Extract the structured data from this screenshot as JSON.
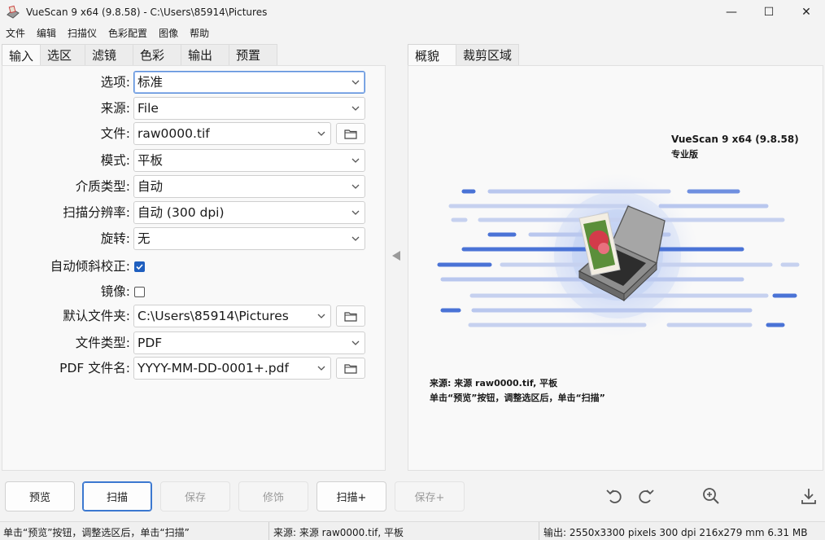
{
  "window": {
    "title": "VueScan 9 x64 (9.8.58)  -  C:\\Users\\85914\\Pictures",
    "minimize": "—",
    "maximize": "☐",
    "close": "✕"
  },
  "menu": [
    "文件",
    "编辑",
    "扫描仪",
    "色彩配置",
    "图像",
    "帮助"
  ],
  "left_tabs": [
    "输入",
    "选区",
    "滤镜",
    "色彩",
    "输出",
    "预置"
  ],
  "right_tabs": [
    "概貌",
    "裁剪区域"
  ],
  "form": {
    "options": {
      "label": "选项:",
      "value": "标准"
    },
    "source": {
      "label": "来源:",
      "value": "File"
    },
    "file": {
      "label": "文件:",
      "value": "raw0000.tif"
    },
    "mode": {
      "label": "模式:",
      "value": "平板"
    },
    "media": {
      "label": "介质类型:",
      "value": "自动"
    },
    "resolution": {
      "label": "扫描分辨率:",
      "value": "自动 (300 dpi)"
    },
    "rotation": {
      "label": "旋转:",
      "value": "无"
    },
    "deskew": {
      "label": "自动倾斜校正:",
      "checked": true
    },
    "mirror": {
      "label": "镜像:",
      "checked": false
    },
    "default_folder": {
      "label": "默认文件夹:",
      "value": "C:\\Users\\85914\\Pictures"
    },
    "file_type": {
      "label": "文件类型:",
      "value": "PDF"
    },
    "pdf_name": {
      "label": "PDF 文件名:",
      "value": "YYYY-MM-DD-0001+.pdf"
    }
  },
  "preview": {
    "product": "VueScan 9 x64 (9.8.58)",
    "edition": "专业版",
    "source_line": "来源: 来源 raw0000.tif, 平板",
    "hint_line": "单击“预览”按钮，调整选区后，单击“扫描”"
  },
  "buttons": {
    "preview": "预览",
    "scan": "扫描",
    "save": "保存",
    "retouch": "修饰",
    "scan_plus": "扫描+",
    "save_plus": "保存+"
  },
  "status": {
    "hint": "单击“预览”按钮，调整选区后，单击“扫描”",
    "source": "来源: 来源 raw0000.tif, 平板",
    "output": "输出: 2550x3300 pixels 300 dpi 216x279 mm 6.31 MB"
  },
  "colors": {
    "accent": "#3b78d0",
    "checkbox": "#1f5fbf",
    "graphic_blue": "#4a73d6"
  }
}
